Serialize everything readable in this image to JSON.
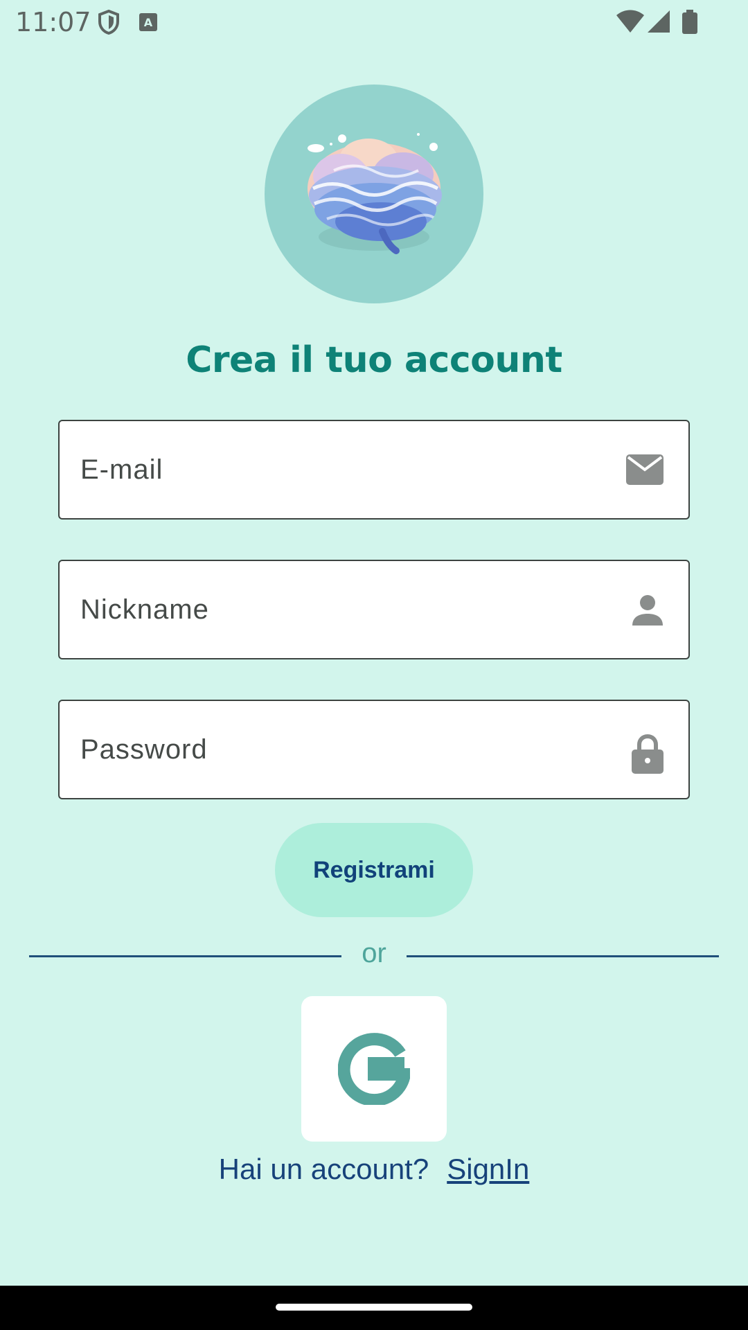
{
  "status_bar": {
    "time": "11:07",
    "icons": [
      "shield-icon",
      "a-icon",
      "wifi-icon",
      "signal-icon",
      "battery-icon"
    ]
  },
  "logo": {
    "icon": "brain-logo"
  },
  "title": "Crea il tuo account",
  "form": {
    "email_placeholder": "E-mail",
    "email_icon": "mail-icon",
    "nickname_placeholder": "Nickname",
    "nickname_icon": "person-icon",
    "password_placeholder": "Password",
    "password_icon": "lock-icon",
    "register_label": "Registrami"
  },
  "divider_label": "or",
  "google_icon": "google-icon",
  "footer": {
    "prompt": "Hai un account?",
    "signin_link": "SignIn"
  },
  "colors": {
    "background": "#d2f5ec",
    "title": "#0e8277",
    "button": "#adeedb",
    "button_text": "#11427a",
    "link": "#17427a"
  }
}
